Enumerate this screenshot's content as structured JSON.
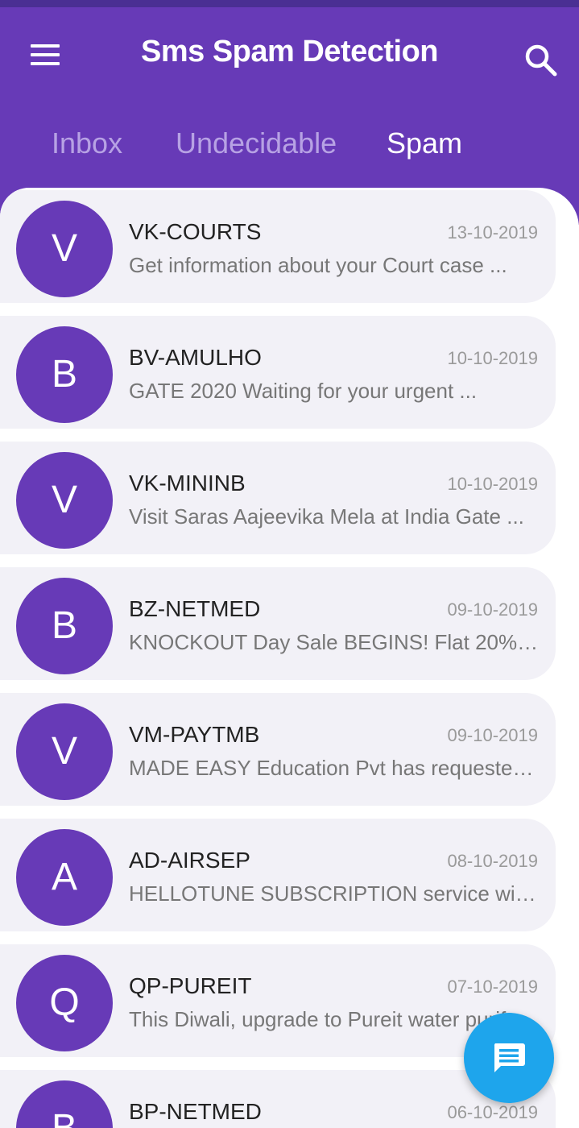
{
  "app": {
    "title": "Sms Spam Detection"
  },
  "colors": {
    "primary": "#673ab7",
    "fab": "#1ea5ec",
    "card": "#f2f1f7"
  },
  "icons": {
    "menu": "menu-icon",
    "search": "search-icon",
    "compose": "message-icon"
  },
  "tabs": [
    {
      "label": "Inbox",
      "active": false
    },
    {
      "label": "Undecidable",
      "active": false
    },
    {
      "label": "Spam",
      "active": true
    }
  ],
  "messages": [
    {
      "initial": "V",
      "sender": "VK-COURTS",
      "date": "13-10-2019",
      "preview": "Get information about your Court case ..."
    },
    {
      "initial": "B",
      "sender": "BV-AMULHO",
      "date": "10-10-2019",
      "preview": "GATE 2020 Waiting for your urgent ..."
    },
    {
      "initial": "V",
      "sender": "VK-MININB",
      "date": "10-10-2019",
      "preview": "Visit Saras Aajeevika Mela at India Gate ..."
    },
    {
      "initial": "B",
      "sender": "BZ-NETMED",
      "date": "09-10-2019",
      "preview": "KNOCKOUT Day Sale BEGINS! Flat 20% ..."
    },
    {
      "initial": "V",
      "sender": "VM-PAYTMB",
      "date": "09-10-2019",
      "preview": "MADE EASY Education Pvt has requested ..."
    },
    {
      "initial": "A",
      "sender": "AD-AIRSEP",
      "date": "08-10-2019",
      "preview": "HELLOTUNE SUBSCRIPTION service will b..."
    },
    {
      "initial": "Q",
      "sender": "QP-PUREIT",
      "date": "07-10-2019",
      "preview": "This Diwali, upgrade to Pureit water purif..."
    },
    {
      "initial": "B",
      "sender": "BP-NETMED",
      "date": "06-10-2019",
      "preview": ""
    }
  ]
}
